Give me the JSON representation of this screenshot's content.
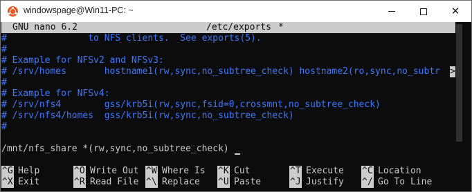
{
  "window": {
    "title": "windowspage@Win11-PC: ~",
    "controls": {
      "minimize_icon": "minimize-icon",
      "maximize_icon": "maximize-icon",
      "close_glyph": "✕"
    }
  },
  "nano": {
    "version": "GNU nano 6.2",
    "filename": "/etc/exports",
    "modified_marker": "*",
    "overflow_marker": ">",
    "colors": {
      "comment": "#3b78ff",
      "text": "#cccccc",
      "background": "#0c0c0c",
      "header_background": "#cccccc"
    },
    "lines": [
      {
        "text": "#               to NFS clients.  See exports(5).",
        "type": "comment"
      },
      {
        "text": "#",
        "type": "comment"
      },
      {
        "text": "# Example for NFSv2 and NFSv3:",
        "type": "comment"
      },
      {
        "text": "# /srv/homes       hostname1(rw,sync,no_subtree_check) hostname2(ro,sync,no_subtr",
        "type": "comment"
      },
      {
        "text": "#",
        "type": "comment"
      },
      {
        "text": "# Example for NFSv4:",
        "type": "comment"
      },
      {
        "text": "# /srv/nfs4        gss/krb5i(rw,sync,fsid=0,crossmnt,no_subtree_check)",
        "type": "comment"
      },
      {
        "text": "# /srv/nfs4/homes  gss/krb5i(rw,sync,no_subtree_check)",
        "type": "comment"
      },
      {
        "text": "#",
        "type": "comment"
      },
      {
        "text": "",
        "type": "text"
      },
      {
        "text": "/mnt/nfs_share *(rw,sync,no_subtree_check)",
        "type": "text"
      }
    ],
    "shortcuts": [
      {
        "key": "^G",
        "label": "Help"
      },
      {
        "key": "^O",
        "label": "Write Out"
      },
      {
        "key": "^W",
        "label": "Where Is"
      },
      {
        "key": "^K",
        "label": "Cut"
      },
      {
        "key": "^T",
        "label": "Execute"
      },
      {
        "key": "^C",
        "label": "Location"
      },
      {
        "key": "^X",
        "label": "Exit"
      },
      {
        "key": "^R",
        "label": "Read File"
      },
      {
        "key": "^\\",
        "label": "Replace"
      },
      {
        "key": "^U",
        "label": "Paste"
      },
      {
        "key": "^J",
        "label": "Justify"
      },
      {
        "key": "^/",
        "label": "Go To Line"
      }
    ]
  }
}
